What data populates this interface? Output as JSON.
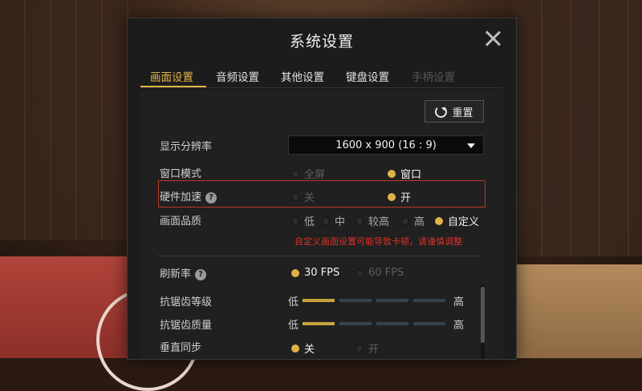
{
  "dialog": {
    "title": "系统设置"
  },
  "tabs": [
    {
      "label": "画面设置"
    },
    {
      "label": "音频设置"
    },
    {
      "label": "其他设置"
    },
    {
      "label": "键盘设置"
    },
    {
      "label": "手柄设置"
    }
  ],
  "reset_label": "重置",
  "settings": {
    "resolution": {
      "label": "显示分辨率",
      "value": "1600 x 900 (16 : 9)"
    },
    "window_mode": {
      "label": "窗口模式",
      "options": [
        "全屏",
        "窗口"
      ],
      "selected": "窗口"
    },
    "hw_accel": {
      "label": "硬件加速",
      "help": "?",
      "options": [
        "关",
        "开"
      ],
      "selected": "开"
    },
    "quality": {
      "label": "画面品质",
      "options": [
        "低",
        "中",
        "较高",
        "高",
        "自定义"
      ],
      "selected": "自定义",
      "warning": "自定义画面设置可能导致卡顿，请谨慎调整"
    },
    "refresh": {
      "label": "刷新率",
      "help": "?",
      "options": [
        "30 FPS",
        "60 FPS"
      ],
      "selected": "30 FPS"
    },
    "aa_level": {
      "label": "抗锯齿等级",
      "low": "低",
      "high": "高",
      "level_fraction": 0.25
    },
    "aa_quality": {
      "label": "抗锯齿质量",
      "low": "低",
      "high": "高",
      "level_fraction": 0.25
    },
    "vsync": {
      "label": "垂直同步",
      "options": [
        "关",
        "开"
      ],
      "selected": "关"
    }
  },
  "colors": {
    "accent": "#e0b24a",
    "warning": "#d8322a",
    "highlight_border": "#b53a2a"
  }
}
